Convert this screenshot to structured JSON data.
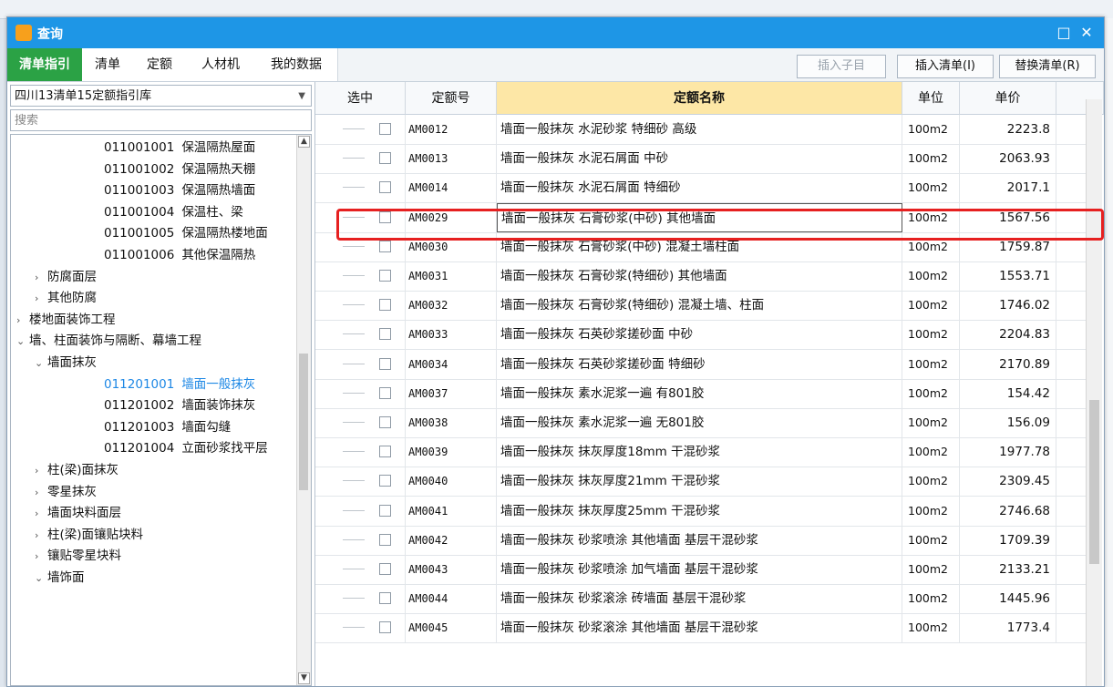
{
  "window": {
    "title": "查询",
    "maximize_glyph": "□",
    "close_glyph": "✕"
  },
  "tabs": [
    "清单指引",
    "清单",
    "定额",
    "人材机",
    "我的数据"
  ],
  "toolbar": {
    "insert_child": "插入子目",
    "insert_list": "插入清单(I)",
    "replace_list": "替换清单(R)"
  },
  "left": {
    "library": "四川13清单15定额指引库",
    "search_placeholder": "搜索",
    "tree": [
      {
        "code": "011001001",
        "label": "保温隔热屋面",
        "level": 3
      },
      {
        "code": "011001002",
        "label": "保温隔热天棚",
        "level": 3
      },
      {
        "code": "011001003",
        "label": "保温隔热墙面",
        "level": 3
      },
      {
        "code": "011001004",
        "label": "保温柱、梁",
        "level": 3
      },
      {
        "code": "011001005",
        "label": "保温隔热楼地面",
        "level": 3
      },
      {
        "code": "011001006",
        "label": "其他保温隔热",
        "level": 3
      },
      {
        "code": "",
        "label": "防腐面层",
        "level": 2,
        "arrow": ">"
      },
      {
        "code": "",
        "label": "其他防腐",
        "level": 2,
        "arrow": ">"
      },
      {
        "code": "",
        "label": "楼地面装饰工程",
        "level": 1,
        "arrow": ">"
      },
      {
        "code": "",
        "label": "墙、柱面装饰与隔断、幕墙工程",
        "level": 1,
        "arrow": "∨"
      },
      {
        "code": "",
        "label": "墙面抹灰",
        "level": 2,
        "arrow": "∨"
      },
      {
        "code": "011201001",
        "label": "墙面一般抹灰",
        "level": 3,
        "selected": true
      },
      {
        "code": "011201002",
        "label": "墙面装饰抹灰",
        "level": 3
      },
      {
        "code": "011201003",
        "label": "墙面勾缝",
        "level": 3
      },
      {
        "code": "011201004",
        "label": "立面砂浆找平层",
        "level": 3
      },
      {
        "code": "",
        "label": "柱(梁)面抹灰",
        "level": 2,
        "arrow": ">"
      },
      {
        "code": "",
        "label": "零星抹灰",
        "level": 2,
        "arrow": ">"
      },
      {
        "code": "",
        "label": "墙面块料面层",
        "level": 2,
        "arrow": ">"
      },
      {
        "code": "",
        "label": "柱(梁)面镶贴块料",
        "level": 2,
        "arrow": ">"
      },
      {
        "code": "",
        "label": "镶贴零星块料",
        "level": 2,
        "arrow": ">"
      },
      {
        "code": "",
        "label": "墙饰面",
        "level": 2,
        "arrow": "∨"
      }
    ]
  },
  "grid": {
    "headers": {
      "select": "选中",
      "code": "定额号",
      "name": "定额名称",
      "unit": "单位",
      "price": "单价"
    },
    "rows": [
      {
        "code": "AM0012",
        "name": "墙面一般抹灰 水泥砂浆 特细砂 高级",
        "unit": "100m2",
        "price": "2223.8"
      },
      {
        "code": "AM0013",
        "name": "墙面一般抹灰 水泥石屑面 中砂",
        "unit": "100m2",
        "price": "2063.93"
      },
      {
        "code": "AM0014",
        "name": "墙面一般抹灰 水泥石屑面 特细砂",
        "unit": "100m2",
        "price": "2017.1"
      },
      {
        "code": "AM0029",
        "name": "墙面一般抹灰 石膏砂浆(中砂) 其他墙面",
        "unit": "100m2",
        "price": "1567.56",
        "focus": true
      },
      {
        "code": "AM0030",
        "name": "墙面一般抹灰 石膏砂浆(中砂) 混凝土墙柱面",
        "unit": "100m2",
        "price": "1759.87"
      },
      {
        "code": "AM0031",
        "name": "墙面一般抹灰 石膏砂浆(特细砂) 其他墙面",
        "unit": "100m2",
        "price": "1553.71"
      },
      {
        "code": "AM0032",
        "name": "墙面一般抹灰 石膏砂浆(特细砂) 混凝土墙、柱面",
        "unit": "100m2",
        "price": "1746.02"
      },
      {
        "code": "AM0033",
        "name": "墙面一般抹灰 石英砂浆搓砂面 中砂",
        "unit": "100m2",
        "price": "2204.83"
      },
      {
        "code": "AM0034",
        "name": "墙面一般抹灰 石英砂浆搓砂面 特细砂",
        "unit": "100m2",
        "price": "2170.89"
      },
      {
        "code": "AM0037",
        "name": "墙面一般抹灰 素水泥浆一遍 有801胶",
        "unit": "100m2",
        "price": "154.42"
      },
      {
        "code": "AM0038",
        "name": "墙面一般抹灰 素水泥浆一遍 无801胶",
        "unit": "100m2",
        "price": "156.09"
      },
      {
        "code": "AM0039",
        "name": "墙面一般抹灰 抹灰厚度18mm 干混砂浆",
        "unit": "100m2",
        "price": "1977.78"
      },
      {
        "code": "AM0040",
        "name": "墙面一般抹灰 抹灰厚度21mm 干混砂浆",
        "unit": "100m2",
        "price": "2309.45"
      },
      {
        "code": "AM0041",
        "name": "墙面一般抹灰 抹灰厚度25mm 干混砂浆",
        "unit": "100m2",
        "price": "2746.68"
      },
      {
        "code": "AM0042",
        "name": "墙面一般抹灰 砂浆喷涂 其他墙面 基层干混砂浆",
        "unit": "100m2",
        "price": "1709.39"
      },
      {
        "code": "AM0043",
        "name": "墙面一般抹灰 砂浆喷涂 加气墙面 基层干混砂浆",
        "unit": "100m2",
        "price": "2133.21"
      },
      {
        "code": "AM0044",
        "name": "墙面一般抹灰 砂浆滚涂 砖墙面 基层干混砂浆",
        "unit": "100m2",
        "price": "1445.96"
      },
      {
        "code": "AM0045",
        "name": "墙面一般抹灰 砂浆滚涂 其他墙面 基层干混砂浆",
        "unit": "100m2",
        "price": "1773.4"
      }
    ]
  }
}
